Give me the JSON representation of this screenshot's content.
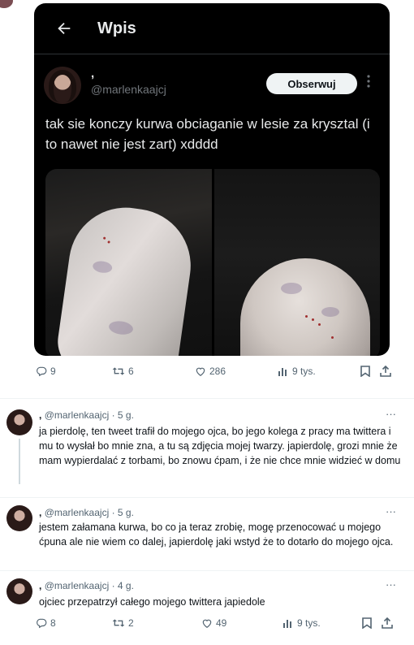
{
  "header": {
    "title": "Wpis",
    "back_icon": "arrow-left-icon"
  },
  "main_tweet": {
    "display_name": ",",
    "handle": "@marlenkaajcj",
    "follow_label": "Obserwuj",
    "more_icon": "more-vertical-icon",
    "text": "tak sie konczy kurwa obciaganie w lesie za krysztal (i to nawet nie jest zart) xdddd"
  },
  "actions_main": {
    "replies": "9",
    "retweets": "6",
    "likes": "286",
    "views": "9 tys."
  },
  "replies": [
    {
      "display_name": ",",
      "handle_time": "@marlenkaajcj · 5 g.",
      "text": "ja pierdolę, ten tweet trafił do mojego ojca, bo jego kolega z pracy ma twittera i mu to wysłał bo mnie zna, a tu są zdjęcia mojej twarzy. japierdolę, grozi mnie że mam wypierdalać z torbami, bo znowu ćpam, i że nie chce mnie widzieć w domu",
      "more": "···"
    },
    {
      "display_name": ",",
      "handle_time": "@marlenkaajcj · 5 g.",
      "text": "jestem załamana kurwa, bo co ja teraz zrobię, mogę przenocować u mojego ćpuna ale nie wiem co dalej, japierdolę jaki wstyd że to dotarło do mojego ojca.",
      "more": "···"
    },
    {
      "display_name": ",",
      "handle_time": "@marlenkaajcj · 4 g.",
      "text": "ojciec przepatrzył całego mojego twittera japiedole",
      "more": "···"
    }
  ],
  "actions_last": {
    "replies": "8",
    "retweets": "2",
    "likes": "49",
    "views": "9 tys."
  },
  "colors": {
    "dark_bg": "#000000",
    "text_light": "#e7e9ea",
    "muted": "#536471"
  }
}
